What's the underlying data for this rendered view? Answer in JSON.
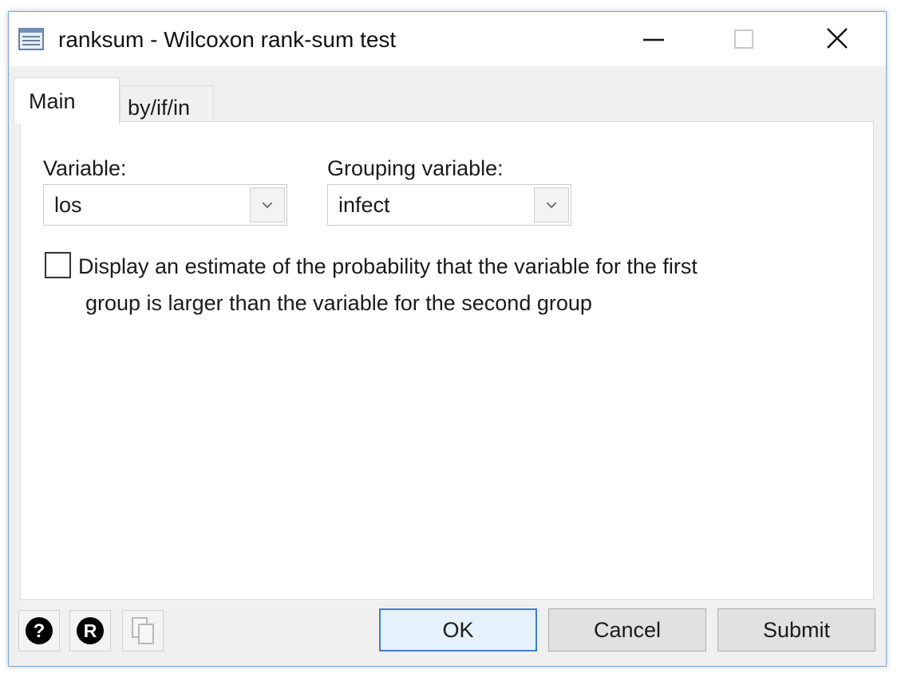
{
  "window": {
    "title": "ranksum - Wilcoxon rank-sum test"
  },
  "tabs": [
    {
      "label": "Main",
      "active": true
    },
    {
      "label": "by/if/in",
      "active": false
    }
  ],
  "main": {
    "variable_label": "Variable:",
    "variable_value": "los",
    "grouping_label": "Grouping variable:",
    "grouping_value": "infect",
    "checkbox_checked": false,
    "checkbox_line1": "Display an estimate of the probability that the variable for the first",
    "checkbox_line2": "group is larger than the variable for the second group"
  },
  "footer": {
    "icons": [
      "help-icon",
      "record-icon",
      "copy-icon"
    ],
    "ok_label": "OK",
    "cancel_label": "Cancel",
    "submit_label": "Submit"
  },
  "colors": {
    "accent": "#3c7fd1",
    "window_border": "#7aa7d8"
  }
}
